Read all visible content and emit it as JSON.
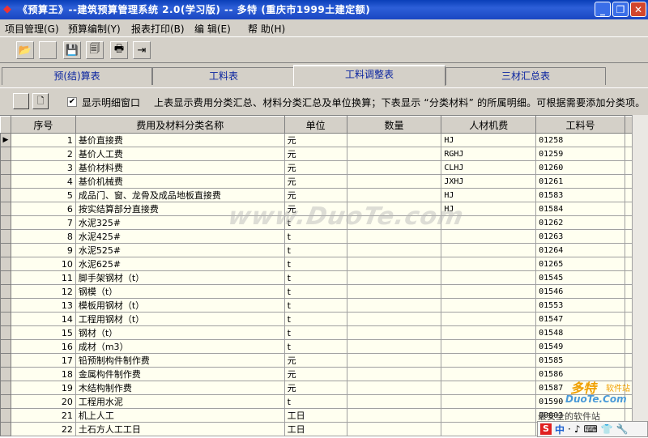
{
  "window": {
    "title": "《预算王》--建筑预算管理系统 2.0(学习版) -- 多特 (重庆市1999土建定额)",
    "app_icon": "diamond-icon",
    "controls": [
      "minimize-icon",
      "restore-icon",
      "close-icon"
    ]
  },
  "menu": {
    "items": [
      "项目管理(G)",
      "预算编制(Y)",
      "报表打印(B)",
      "编 辑(E)",
      "帮 助(H)"
    ]
  },
  "toolbar": {
    "buttons": [
      "open-folder-icon",
      "blank-icon",
      "save-icon",
      "save-all-icon",
      "print-icon",
      "exit-icon"
    ]
  },
  "tabs": {
    "items": [
      "预(结)算表",
      "工料表",
      "工料调整表",
      "三材汇总表"
    ],
    "active": 2
  },
  "strip": {
    "checkbox_label": "显示明细窗口",
    "checkbox_checked": true,
    "hint": "上表显示费用分类汇总、材料分类汇总及单位换算；下表显示 “分类材料” 的所属明细。可根据需要添加分类项。"
  },
  "grid": {
    "columns": [
      "序号",
      "费用及材料分类名称",
      "单位",
      "数量",
      "人材机费",
      "工料号"
    ],
    "rows": [
      [
        "1",
        "基价直接费",
        "元",
        "",
        "HJ",
        "01258"
      ],
      [
        "2",
        "基价人工费",
        "元",
        "",
        "RGHJ",
        "01259"
      ],
      [
        "3",
        "基价材料费",
        "元",
        "",
        "CLHJ",
        "01260"
      ],
      [
        "4",
        "基价机械费",
        "元",
        "",
        "JXHJ",
        "01261"
      ],
      [
        "5",
        "成品门、窗、龙骨及成品地板直接费",
        "元",
        "",
        "HJ",
        "01583"
      ],
      [
        "6",
        "按实结算部分直接费",
        "元",
        "",
        "HJ",
        "01584"
      ],
      [
        "7",
        "水泥325#",
        "t",
        "",
        "",
        "01262"
      ],
      [
        "8",
        "水泥425#",
        "t",
        "",
        "",
        "01263"
      ],
      [
        "9",
        "水泥525#",
        "t",
        "",
        "",
        "01264"
      ],
      [
        "10",
        "水泥625#",
        "t",
        "",
        "",
        "01265"
      ],
      [
        "11",
        "脚手架钢材（t）",
        "t",
        "",
        "",
        "01545"
      ],
      [
        "12",
        "钢模（t）",
        "t",
        "",
        "",
        "01546"
      ],
      [
        "13",
        "模板用钢材（t）",
        "t",
        "",
        "",
        "01553"
      ],
      [
        "14",
        "工程用钢材（t）",
        "t",
        "",
        "",
        "01547"
      ],
      [
        "15",
        "钢材（t）",
        "t",
        "",
        "",
        "01548"
      ],
      [
        "16",
        "成材（m3）",
        "t",
        "",
        "",
        "01549"
      ],
      [
        "17",
        "铅预制构件制作费",
        "元",
        "",
        "",
        "01585"
      ],
      [
        "18",
        "金属构件制作费",
        "元",
        "",
        "",
        "01586"
      ],
      [
        "19",
        "木结构制作费",
        "元",
        "",
        "",
        "01587"
      ],
      [
        "20",
        "工程用水泥",
        "t",
        "",
        "",
        "01590"
      ],
      [
        "21",
        "机上人工",
        "工日",
        "",
        "",
        "00003"
      ],
      [
        "22",
        "土石方人工工日",
        "工日",
        "",
        "",
        ""
      ]
    ]
  },
  "watermark": "www.DuoTe.com",
  "corner_logo": {
    "line1": "多特",
    "line1b": "软件站",
    "line2": "DuoTe.Com",
    "line3": "最安全的软件站"
  },
  "ime_bar": {
    "items": [
      "S",
      "中",
      "·",
      "♪",
      "⌨",
      "👕",
      "🔧"
    ]
  }
}
